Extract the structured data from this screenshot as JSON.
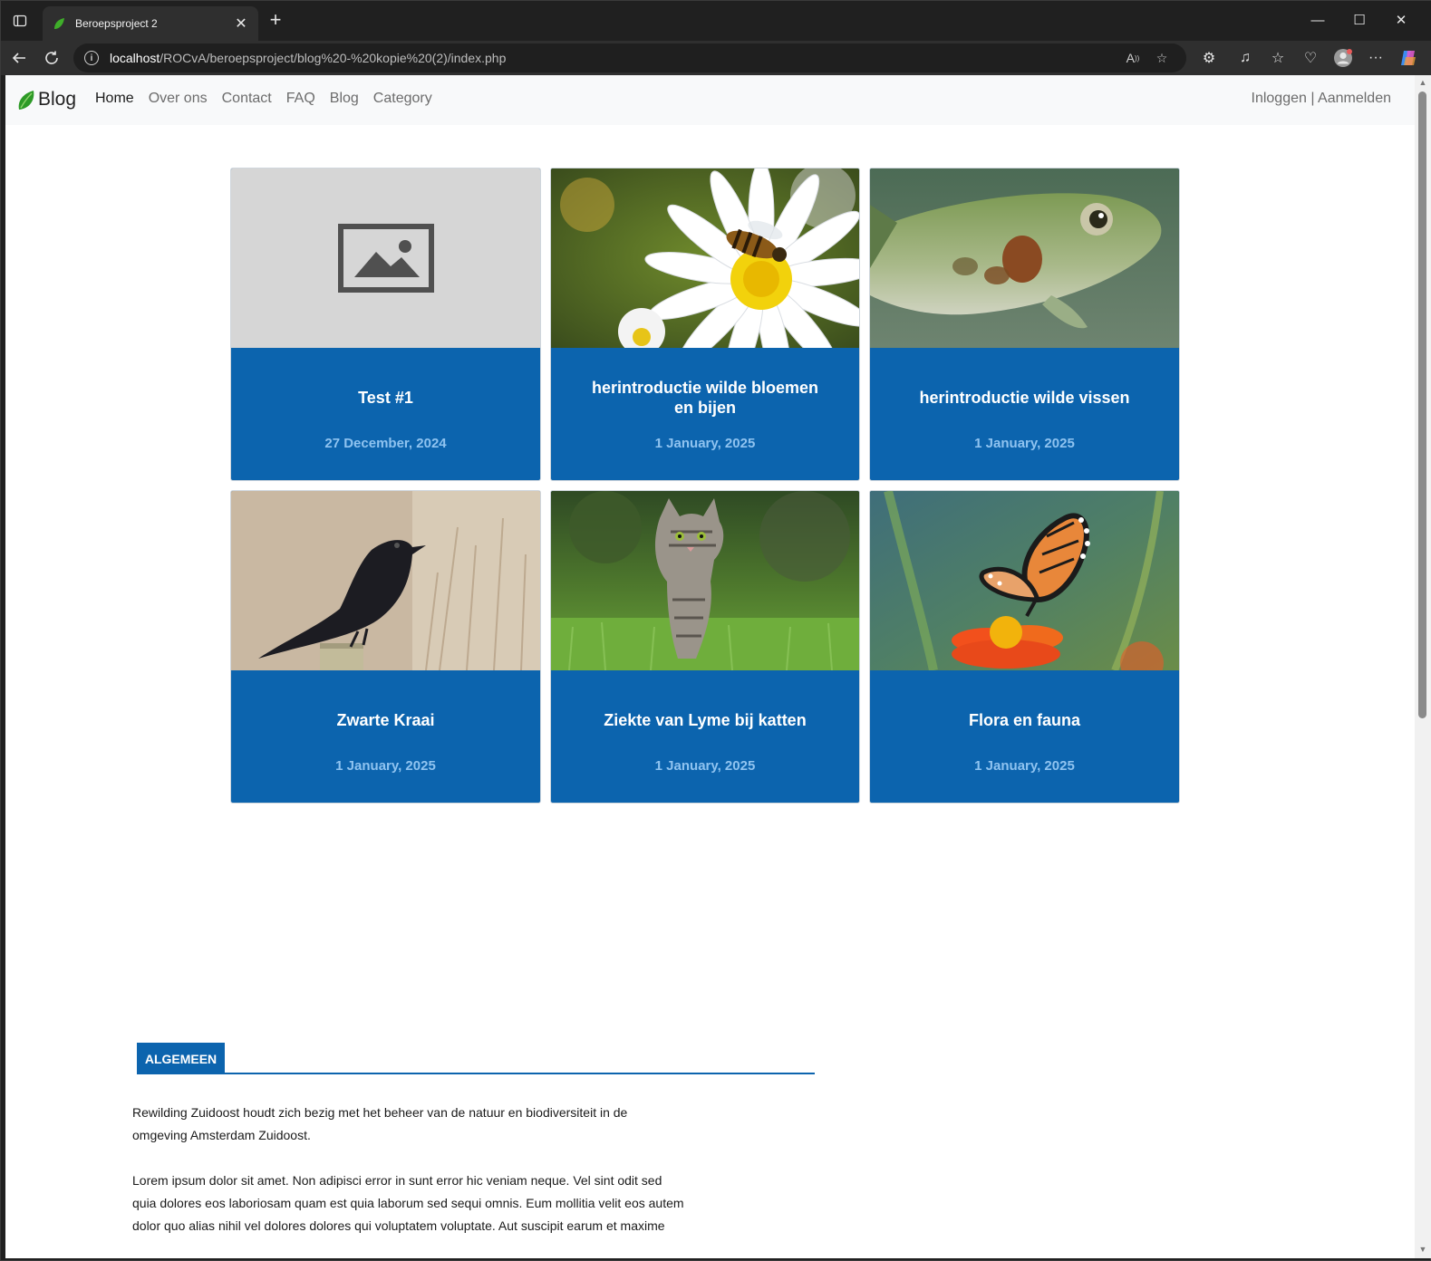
{
  "browser": {
    "tab_title": "Beroepsproject 2",
    "url_host": "localhost",
    "url_path": "/ROCvA/beroepsproject/blog%20-%20kopie%20(2)/index.php"
  },
  "navbar": {
    "brand": "Blog",
    "links": [
      "Home",
      "Over ons",
      "Contact",
      "FAQ",
      "Blog",
      "Category"
    ],
    "auth": "Inloggen | Aanmelden"
  },
  "cards": [
    {
      "title": "Test #1",
      "date": "27 December, 2024",
      "image": "placeholder-image-icon"
    },
    {
      "title": "herintroductie wilde bloemen en bijen",
      "date": "1 January, 2025",
      "image": "bee-on-daisy"
    },
    {
      "title": "herintroductie wilde vissen",
      "date": "1 January, 2025",
      "image": "fish"
    },
    {
      "title": "Zwarte Kraai",
      "date": "1 January, 2025",
      "image": "crow"
    },
    {
      "title": "Ziekte van Lyme bij katten",
      "date": "1 January, 2025",
      "image": "kitten"
    },
    {
      "title": "Flora en fauna",
      "date": "1 January, 2025",
      "image": "butterfly"
    }
  ],
  "section": {
    "tag": "ALGEMEEN",
    "p1": "Rewilding Zuidoost houdt zich bezig met het beheer van de natuur en biodiversiteit in de omgeving Amsterdam Zuidoost.",
    "p2": "Lorem ipsum dolor sit amet. Non adipisci error in sunt error hic veniam neque. Vel sint odit sed quia dolores eos laboriosam quam est quia laborum sed sequi omnis. Eum mollitia velit eos autem dolor quo alias nihil vel dolores dolores qui voluptatem voluptate. Aut suscipit earum et maxime"
  },
  "colors": {
    "accent": "#0c64ae",
    "date": "#8fc3f0"
  }
}
